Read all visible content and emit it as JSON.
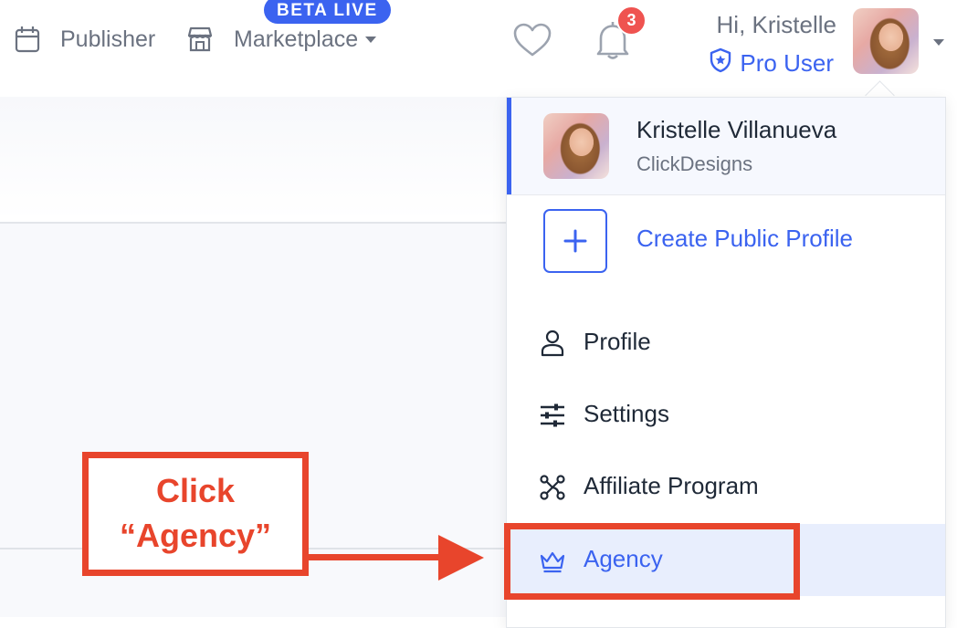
{
  "topnav": {
    "publisher_label": "Publisher",
    "marketplace_label": "Marketplace",
    "beta_badge": "BETA LIVE",
    "notification_count": "3"
  },
  "user": {
    "greeting": "Hi, Kristelle",
    "plan": "Pro User",
    "full_name": "Kristelle Villanueva",
    "company": "ClickDesigns"
  },
  "menu": {
    "create_profile": "Create Public Profile",
    "items": [
      {
        "label": "Profile",
        "icon": "person-icon"
      },
      {
        "label": "Settings",
        "icon": "sliders-icon"
      },
      {
        "label": "Affiliate Program",
        "icon": "affiliate-network-icon"
      },
      {
        "label": "Agency",
        "icon": "crown-icon",
        "active": true
      }
    ]
  },
  "annotation": {
    "line1": "Click",
    "line2": "“Agency”"
  },
  "colors": {
    "accent": "#3b63f0",
    "annotation": "#e8452c",
    "badge": "#ef5350",
    "muted_text": "#6b7280"
  }
}
